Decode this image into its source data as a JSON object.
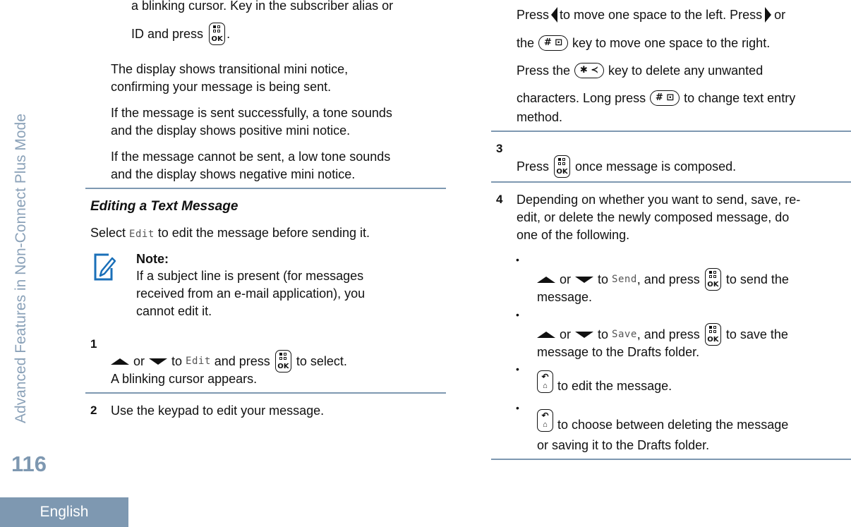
{
  "sidebar": {
    "section_title": "Advanced Features in Non-Connect Plus Mode",
    "page_number": "116",
    "language": "English"
  },
  "colors": {
    "accent": "#7e98b1",
    "note_icon": "#1a6fb8",
    "text": "#111111"
  },
  "left_column": {
    "cont_line1": "a blinking cursor. Key in the subscriber alias or",
    "cont_line2_a": "ID and press",
    "cont_line2_b": ".",
    "p1_l1": "The display shows transitional mini notice,",
    "p1_l2": "confirming your message is being sent.",
    "p2_l1": "If the message is sent successfully, a tone sounds",
    "p2_l2": "and the display shows positive mini notice.",
    "p3_l1": "If the message cannot be sent, a low tone sounds",
    "p3_l2": "and the display shows negative mini notice.",
    "heading": "Editing a Text Message",
    "intro_a": "Select",
    "intro_code": "Edit",
    "intro_b": "to edit the message before sending it.",
    "note": {
      "label": "Note:",
      "l1": "If a subject line is present (for messages",
      "l2": "received from an e-mail application), you",
      "l3": "cannot edit it."
    },
    "steps": [
      {
        "num": "1",
        "a": "or",
        "b": "to",
        "code": "Edit",
        "c": "and press",
        "d": "to select.",
        "result": "A blinking cursor appears."
      },
      {
        "num": "2",
        "text": "Use the keypad to edit your message."
      }
    ]
  },
  "right_column": {
    "l1_a": "Press",
    "l1_b": "to move one space to the left. Press",
    "l1_c": "or",
    "l2_a": "the",
    "l2_b": "key to move one space to the right.",
    "l3_a": "Press the",
    "l3_b": "key to delete any unwanted",
    "l4_a": "characters. Long press",
    "l4_b": "to change text entry",
    "l5": "method.",
    "keys": {
      "ok": "OK",
      "hash": "#",
      "star": "✱"
    },
    "steps": [
      {
        "num": "3",
        "a": "Press",
        "b": "once message is composed."
      },
      {
        "num": "4",
        "l1": "Depending on whether you want to send, save, re-",
        "l2": "edit, or delete the newly composed message, do",
        "l3": "one of the following."
      }
    ],
    "bullets": [
      {
        "a": "or",
        "b": "to",
        "code": "Send",
        "c": ", and press",
        "d": "to send the",
        "e": "message."
      },
      {
        "a": "or",
        "b": "to",
        "code": "Save",
        "c": ", and press",
        "d": "to save the",
        "e": "message to the Drafts folder."
      },
      {
        "d": "to edit the message."
      },
      {
        "d": "to choose between deleting the message",
        "e": "or saving it to the Drafts folder."
      }
    ],
    "bullet_char": "•"
  }
}
